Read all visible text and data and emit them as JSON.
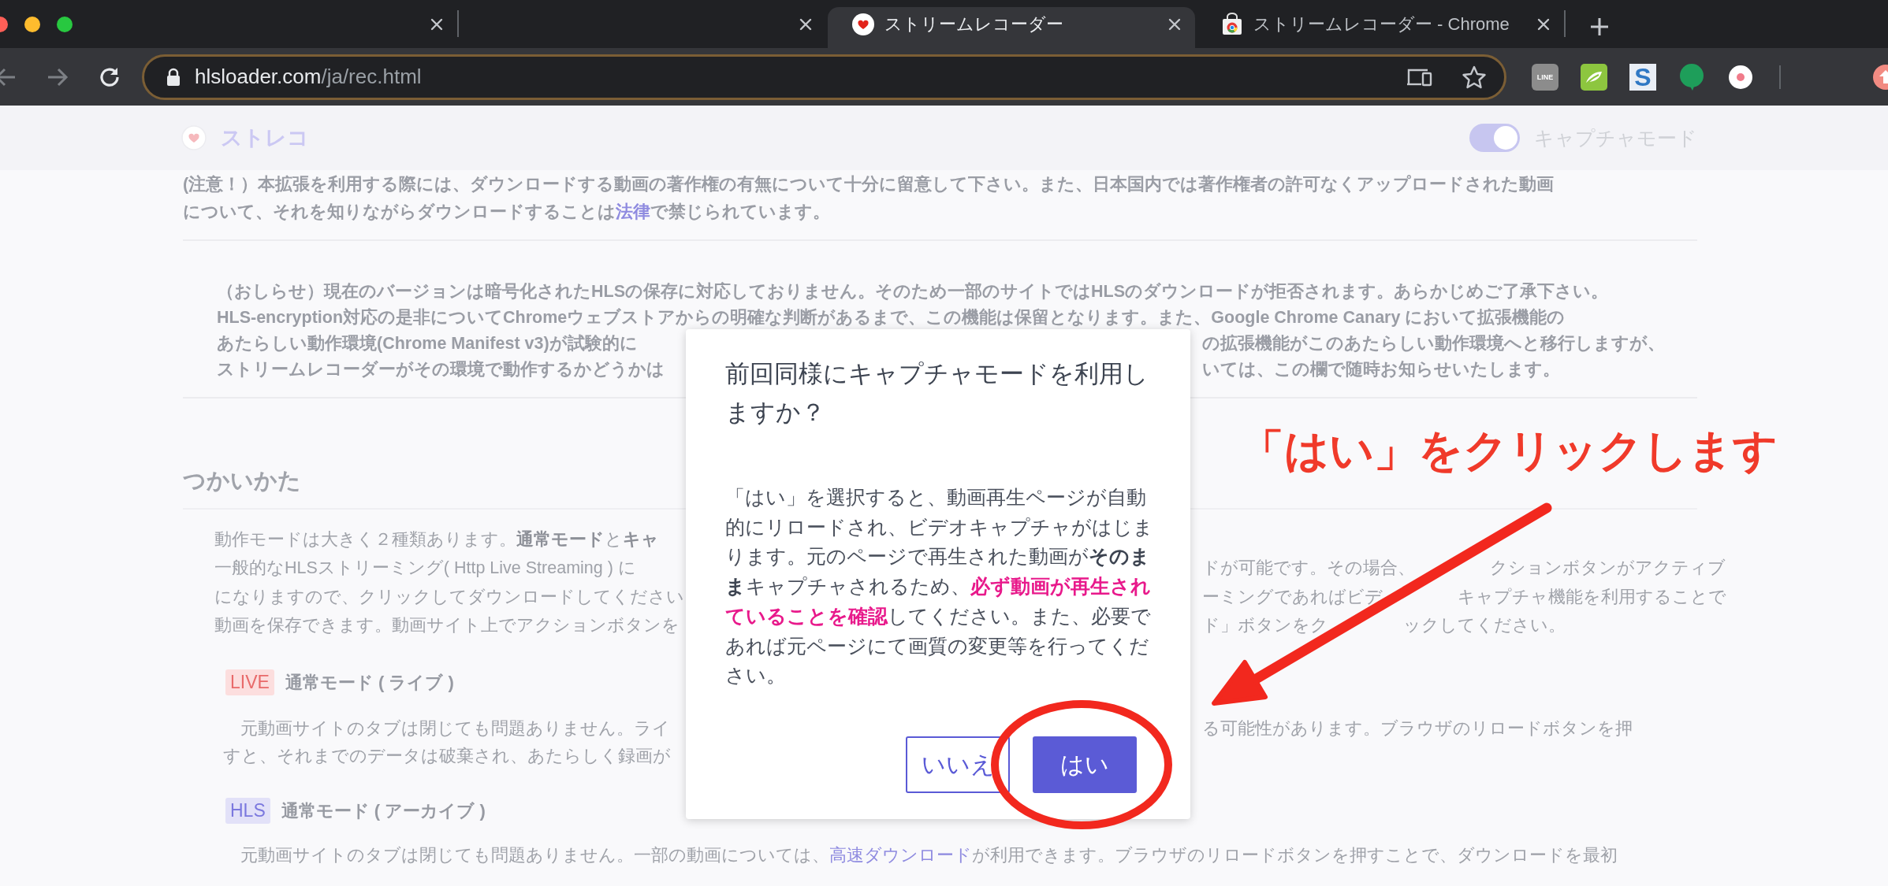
{
  "browser": {
    "tabs": [
      {
        "selected": false
      },
      {
        "selected": false
      },
      {
        "title": "ストリームレコーダー",
        "favicon": {
          "kind": "heart"
        },
        "selected": true
      },
      {
        "title": "ストリームレコーダー - Chrome",
        "favicon": {
          "kind": "store"
        },
        "selected": false
      }
    ],
    "url": {
      "host": "hlsloader.com",
      "path": "/ja/rec.html"
    },
    "extensions": [
      {
        "kind": "line",
        "label": "LINE"
      },
      {
        "kind": "leaf"
      },
      {
        "kind": "letter",
        "label": "S"
      },
      {
        "kind": "bubble"
      },
      {
        "kind": "record"
      }
    ]
  },
  "page": {
    "brand": "ストレコ",
    "capture_toggle": {
      "label": "キャプチャモード",
      "on": true
    },
    "notices": [
      {
        "lines": [
          {
            "left": [
              {
                "kind": "text",
                "text": "(注意！）本拡張を利用する際には、ダウンロードする動画の著作権の有無について十分に留意して下さい。また、日本国内では著作権者の許可なくアップロードされた動画"
              }
            ]
          },
          {
            "left": [
              {
                "kind": "text",
                "text": "について、それを知りながらダウンロードすることは"
              },
              {
                "kind": "link",
                "text": "法律"
              },
              {
                "kind": "text",
                "text": "で禁じられています。"
              }
            ]
          }
        ]
      },
      {
        "lines": [
          {
            "left": [
              {
                "kind": "text",
                "text": "（おしらせ）現在のバージョンは暗号化されたHLSの保存に対応しておりません。そのため一部のサイトではHLSのダウンロードが拒否されます。あらかじめご了承下さい。"
              }
            ]
          },
          {
            "left": [
              {
                "kind": "text",
                "text": "HLS-encryption対応の是非についてChromeウェブストアからの明確な判断があるまで、この機能は保留となります。また、Google Chrome Canary において拡張機能の"
              }
            ]
          },
          {
            "left": [
              {
                "kind": "text",
                "text": "あたらしい動作環境(Chrome Manifest v3)が試験的に"
              }
            ],
            "right": [
              "の拡張機能がこのあたらしい動作環境へと移行しますが、"
            ]
          },
          {
            "left": [
              {
                "kind": "text",
                "text": "ストリームレコーダーがその環境で動作するかどうかは"
              }
            ],
            "right": [
              "いては、この欄で随時お知らせいたします。"
            ]
          }
        ]
      }
    ],
    "usage": {
      "heading": "つかいかた",
      "intro": [
        {
          "left": [
            {
              "kind": "text",
              "text": "動作モードは大きく２種類あります。**通常モード**と**キャ**"
            }
          ]
        },
        {
          "left": [
            {
              "kind": "text",
              "text": "一般的なHLSストリーミング( Http Live Streaming ) に"
            }
          ],
          "right": [
            "ドが可能です。その場合、",
            "クションボタンがアクティブ"
          ]
        },
        {
          "left": [
            {
              "kind": "text",
              "text": "になりますので、クリックしてダウンロードしてください"
            }
          ],
          "right": [
            "ーミングであればビデ",
            "キャプチャ機能を利用することで"
          ]
        },
        {
          "left": [
            {
              "kind": "text",
              "text": "動画を保存できます。動画サイト上でアクションボタンを"
            }
          ],
          "right": [
            "ド」ボタンをク",
            "ックしてください。"
          ]
        }
      ],
      "modes": [
        {
          "badge": "LIVE",
          "kind": "live",
          "title": "通常モード ( ライブ )",
          "lines": [
            {
              "left": [
                {
                  "kind": "text",
                  "text": "　元動画サイトのタブは閉じても問題ありません。ライ"
                }
              ],
              "right": [
                "る可能性があります。ブラウザのリロードボタンを押"
              ]
            },
            {
              "left": [
                {
                  "kind": "text",
                  "text": "すと、それまでのデータは破棄され、あたらしく録画が"
                }
              ]
            }
          ]
        },
        {
          "badge": "HLS",
          "kind": "hls",
          "title": "通常モード ( アーカイブ )",
          "lines": [
            {
              "left": [
                {
                  "kind": "text",
                  "text": "　元動画サイトのタブは閉じても問題ありません。一部の動画については、"
                },
                {
                  "kind": "link",
                  "text": "高速ダウンロード"
                },
                {
                  "kind": "text",
                  "text": "が利用できます。ブラウザのリロードボタンを押すことで、ダウンロードを最初"
                }
              ]
            }
          ]
        }
      ]
    }
  },
  "dialog": {
    "title": "前回同様にキャプチャモードを利用しますか？",
    "body": [
      {
        "kind": "plain",
        "text": "「はい」を選択すると、動画再生ページが自動的にリロードされ、ビデオキャプチャがはじまります。元のページで再生された動画が"
      },
      {
        "kind": "strong",
        "text": "そのまま"
      },
      {
        "kind": "plain",
        "text": "キャプチャされるため、"
      },
      {
        "kind": "emphasis",
        "text": "必ず動画が再生されていることを確認"
      },
      {
        "kind": "plain",
        "text": "してください。また、必要であれば元ページにて画質の変更等を行ってください。"
      }
    ],
    "buttons": [
      {
        "label": "いいえ",
        "kind": "secondary"
      },
      {
        "label": "はい",
        "kind": "primary"
      }
    ]
  },
  "annotation": {
    "text": "「はい」をクリックします"
  }
}
